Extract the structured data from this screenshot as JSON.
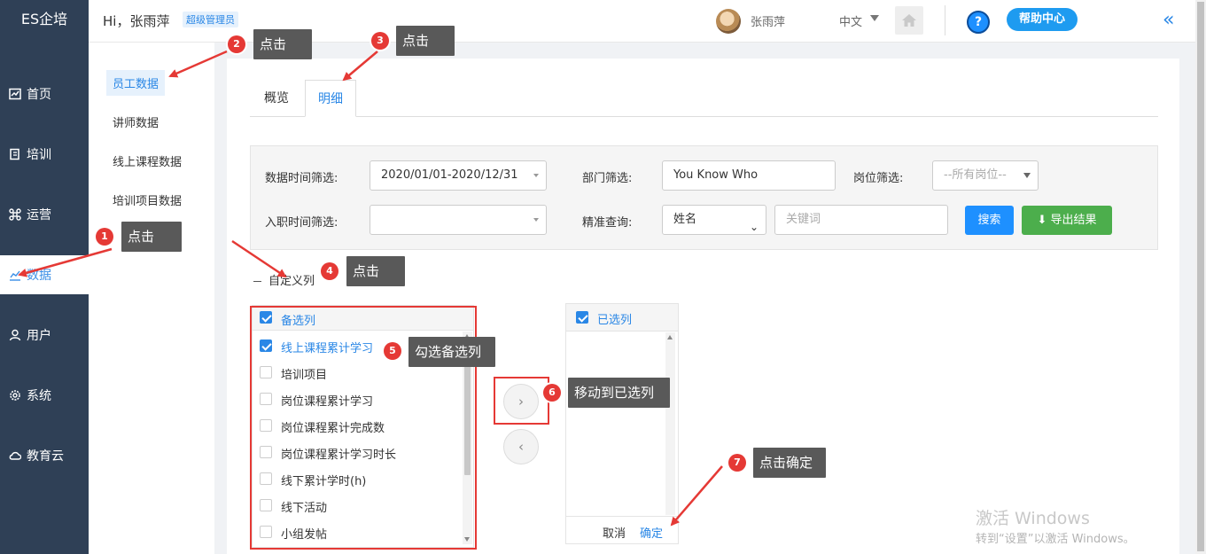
{
  "app": {
    "logo": "ES企培"
  },
  "nav": [
    {
      "label": "首页",
      "icon": "chart-board-icon"
    },
    {
      "label": "培训",
      "icon": "book-icon"
    },
    {
      "label": "运营",
      "icon": "command-icon"
    },
    {
      "label": "数据",
      "icon": "line-chart-icon",
      "active": true
    },
    {
      "label": "用户",
      "icon": "user-icon"
    },
    {
      "label": "系统",
      "icon": "gear-icon"
    },
    {
      "label": "教育云",
      "icon": "cloud-icon"
    }
  ],
  "header": {
    "greeting": "Hi，张雨萍",
    "role": "超级管理员",
    "username": "张雨萍",
    "language": "中文",
    "help_label": "帮助中心",
    "help_symbol": "?",
    "collapse_symbol": "«"
  },
  "submenu": [
    {
      "label": "员工数据",
      "active": true
    },
    {
      "label": "讲师数据"
    },
    {
      "label": "线上课程数据"
    },
    {
      "label": "培训项目数据"
    }
  ],
  "tabs": [
    {
      "label": "概览"
    },
    {
      "label": "明细",
      "active": true
    }
  ],
  "filters": {
    "date_label": "数据时间筛选:",
    "date_value": "2020/01/01-2020/12/31",
    "dept_label": "部门筛选:",
    "dept_value": "You Know Who",
    "post_label": "岗位筛选:",
    "post_value": "--所有岗位--",
    "hire_label": "入职时间筛选:",
    "hire_value": "",
    "exact_label": "精准查询:",
    "exact_field": "姓名",
    "keyword_placeholder": "关键词",
    "search_btn": "搜索",
    "export_btn": "导出结果"
  },
  "custom_columns_label": "自定义列",
  "transfer": {
    "available_title": "备选列",
    "available_items": [
      {
        "label": "线上课程累计学习",
        "checked": true
      },
      {
        "label": "培训项目",
        "checked": false
      },
      {
        "label": "岗位课程累计学习",
        "checked": false
      },
      {
        "label": "岗位课程累计完成数",
        "checked": false
      },
      {
        "label": "岗位课程累计学习时长",
        "checked": false
      },
      {
        "label": "线下累计学时(h)",
        "checked": false
      },
      {
        "label": "线下活动",
        "checked": false
      },
      {
        "label": "小组发帖",
        "checked": false
      }
    ],
    "selected_title": "已选列",
    "move_right": "›",
    "move_left": "‹",
    "cancel": "取消",
    "confirm": "确定"
  },
  "annotations": [
    {
      "num": "1",
      "text": "点击"
    },
    {
      "num": "2",
      "text": "点击"
    },
    {
      "num": "3",
      "text": "点击"
    },
    {
      "num": "4",
      "text": "点击"
    },
    {
      "num": "5",
      "text": "勾选备选列"
    },
    {
      "num": "6",
      "text": "移动到已选列"
    },
    {
      "num": "7",
      "text": "点击确定"
    }
  ],
  "watermark": {
    "line1": "激活 Windows",
    "line2": "转到“设置”以激活 Windows。"
  },
  "colors": {
    "nav_bg": "#2f4056",
    "accent": "#2a87e6",
    "search": "#1e90ff",
    "export": "#4cae4c",
    "annotation_red": "#e53935",
    "callout_bg": "#595959"
  }
}
